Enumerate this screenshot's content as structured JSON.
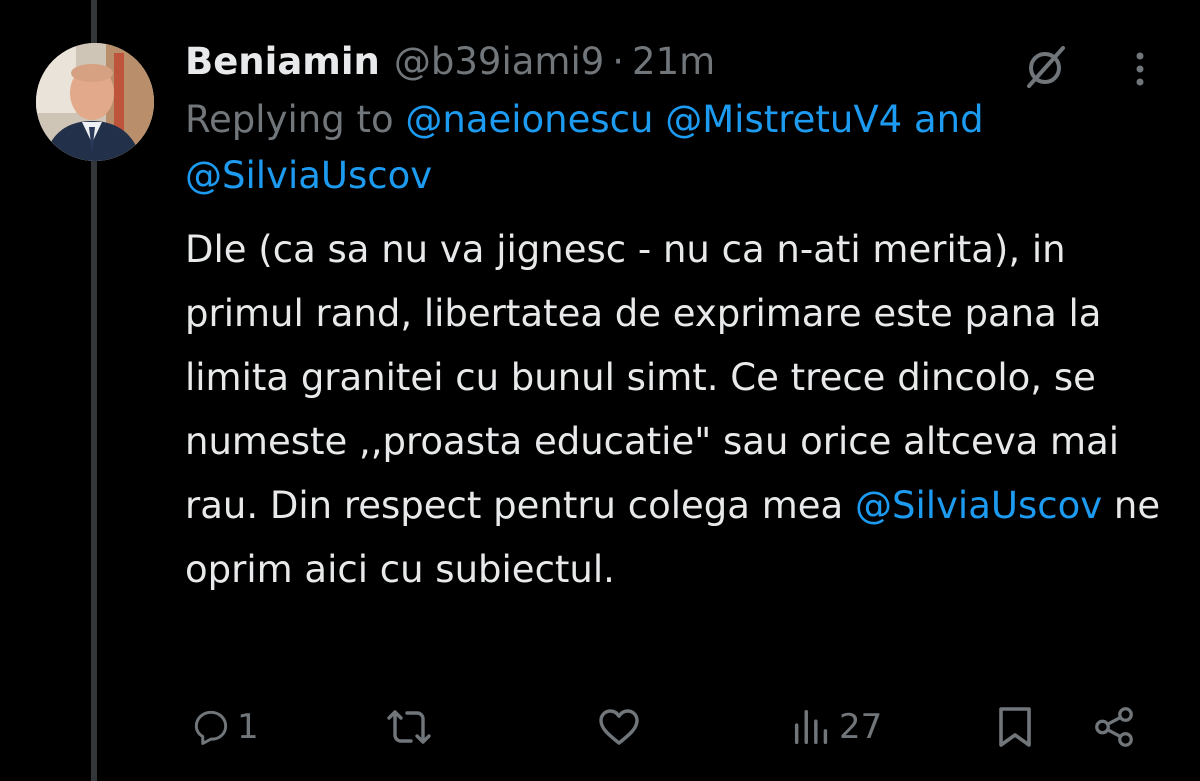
{
  "author": {
    "display_name": "Beniamin",
    "handle": "@b39iami9",
    "separator": "·",
    "time": "21m"
  },
  "reply": {
    "prefix": "Replying to",
    "mention_1": "@naeionescu",
    "mention_2": "@MistretuV4",
    "conjunction": "and",
    "mention_3": "@SilviaUscov"
  },
  "body": {
    "text_before": "Dle (ca sa nu va jignesc - nu ca n-ati merita), in primul rand, libertatea de exprimare este pana la limita granitei cu bunul simt. Ce trece dincolo, se numeste ,,proasta educatie\" sau orice altceva mai rau. Din respect pentru colega mea",
    "mention": "@SilviaUscov",
    "text_after": "ne oprim aici cu subiectul."
  },
  "actions": {
    "reply_count": "1",
    "retweet_count": "",
    "like_count": "",
    "views_count": "27"
  },
  "icons": {
    "grok": "grok-icon",
    "more": "more-vertical-icon",
    "reply": "reply-icon",
    "retweet": "retweet-icon",
    "like": "heart-icon",
    "views": "views-icon",
    "bookmark": "bookmark-icon",
    "share": "share-icon"
  },
  "colors": {
    "background": "#000000",
    "text_primary": "#e7e9ea",
    "text_secondary": "#71767b",
    "accent": "#1d9bf0",
    "thread_line": "#333639"
  }
}
